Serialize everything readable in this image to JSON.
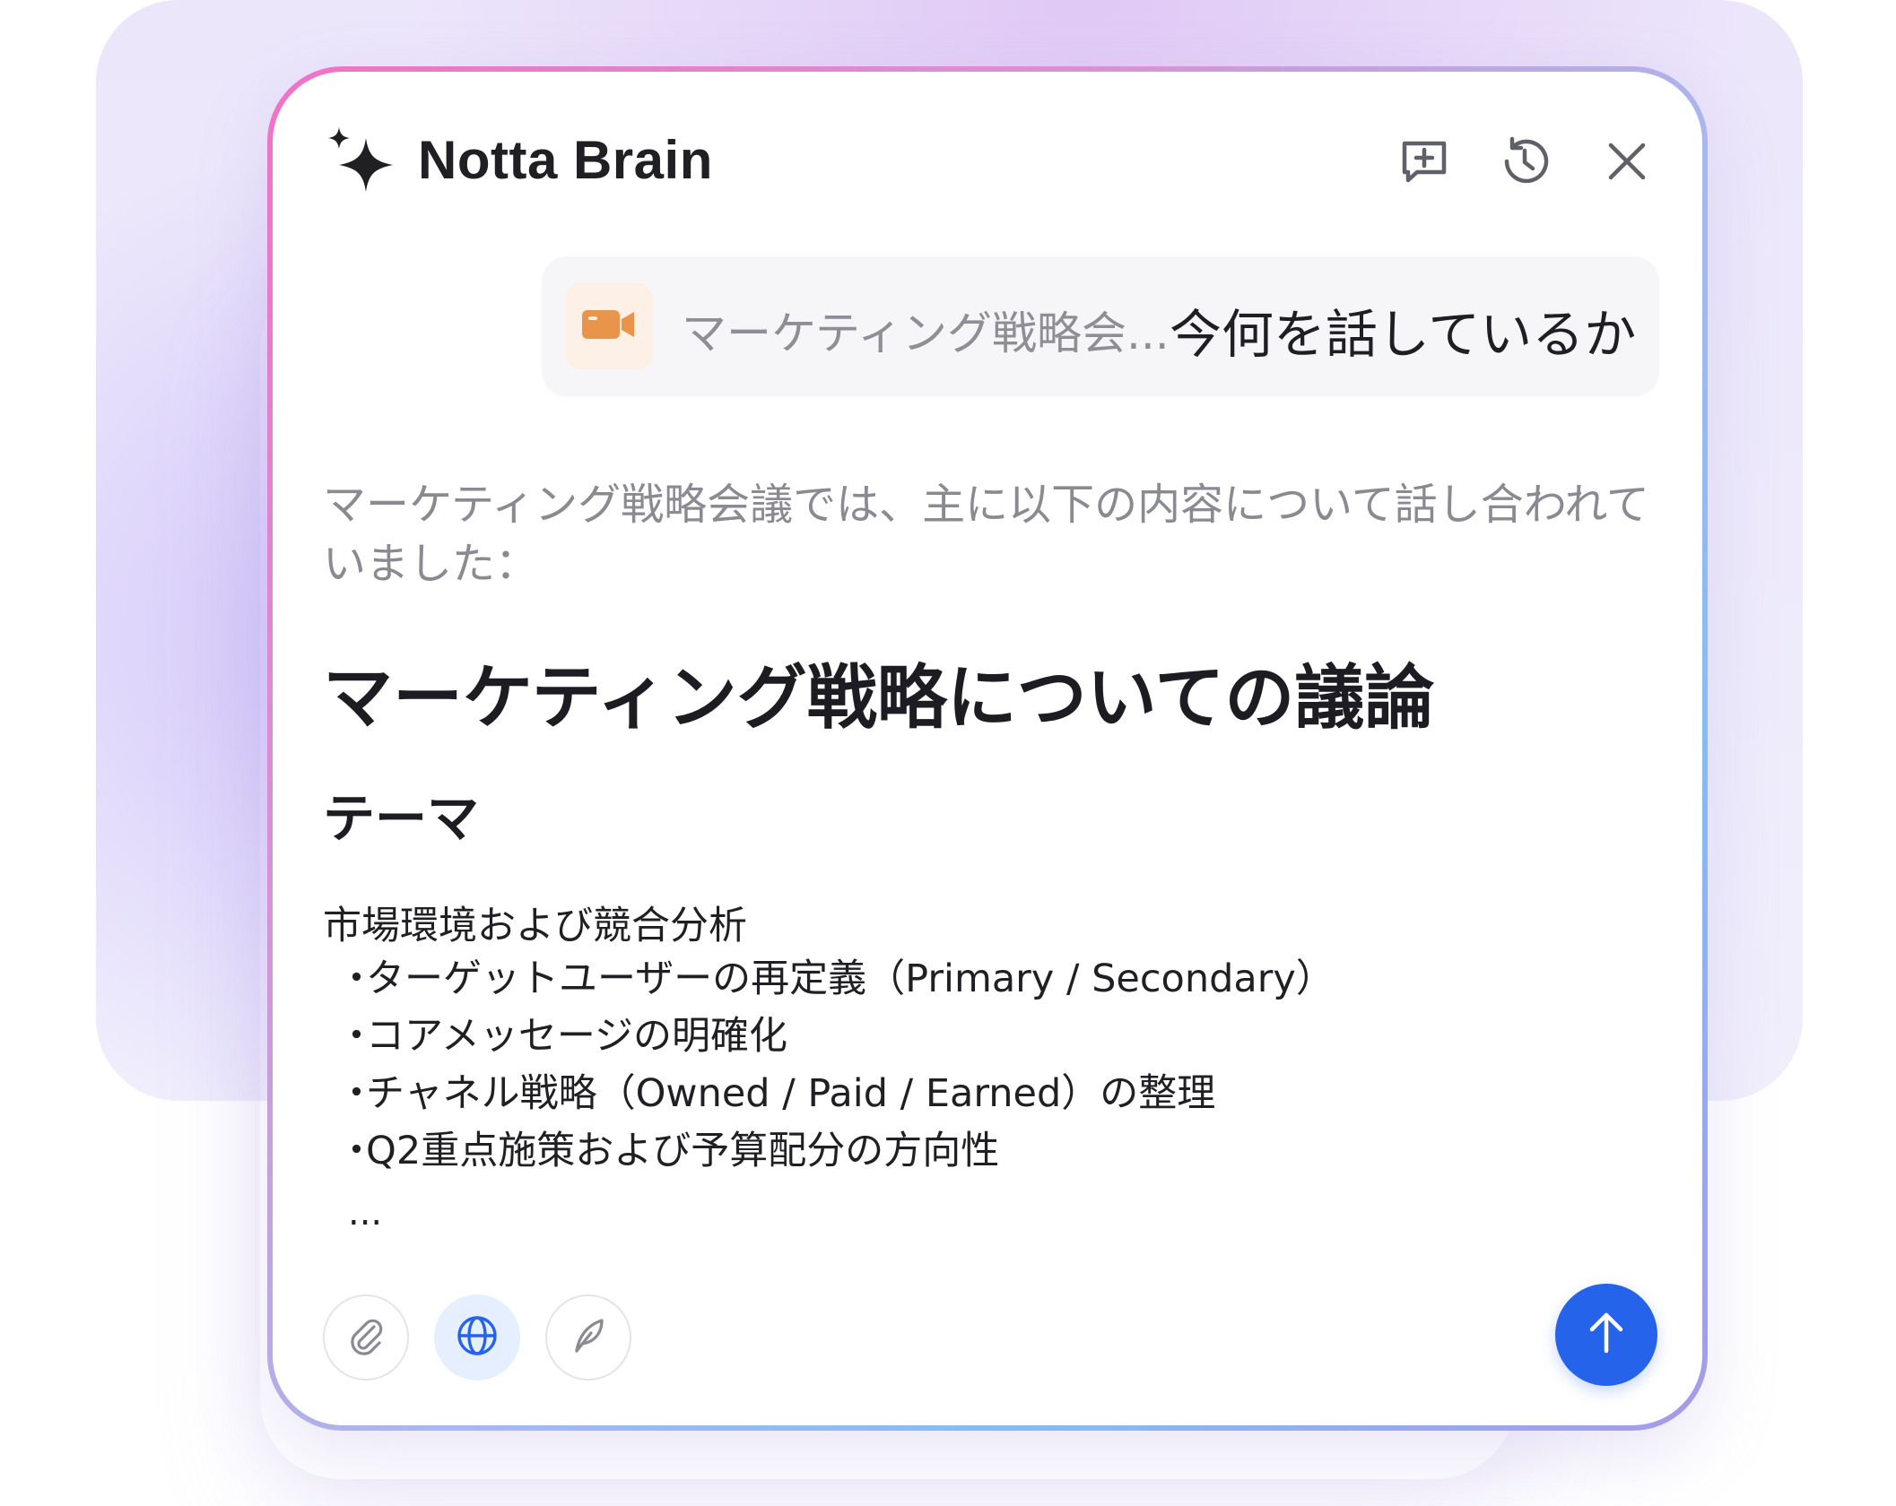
{
  "app": {
    "title": "Notta Brain",
    "icons": {
      "brand": "sparkle-icon",
      "new_chat": "new-chat-icon",
      "history": "history-icon",
      "close": "close-icon"
    }
  },
  "query": {
    "file_icon": "video-camera-icon",
    "file_name": "マーケティング戦略会...",
    "text": "今何を話しているか"
  },
  "answer": {
    "intro": "マーケティング戦略会議では、主に以下の内容について話し合われていました：",
    "title": "マーケティング戦略についての議論",
    "section_title": "テーマ",
    "topic": "市場環境および競合分析",
    "bullets": [
      "ターゲットユーザーの再定義（Primary / Secondary）",
      "コアメッセージの明確化",
      "チャネル戦略（Owned / Paid / Earned）の整理",
      "Q2重点施策および予算配分の方向性"
    ],
    "ellipsis": "..."
  },
  "toolbar": {
    "attach_icon": "paperclip-icon",
    "web_icon": "globe-icon",
    "write_icon": "feather-icon",
    "send_icon": "arrow-up-icon",
    "active_tool": "web"
  },
  "colors": {
    "accent": "#2563eb",
    "file_icon": "#e9944a",
    "border_gradient_start": "#f171c6",
    "border_gradient_end": "#84bcf3"
  }
}
